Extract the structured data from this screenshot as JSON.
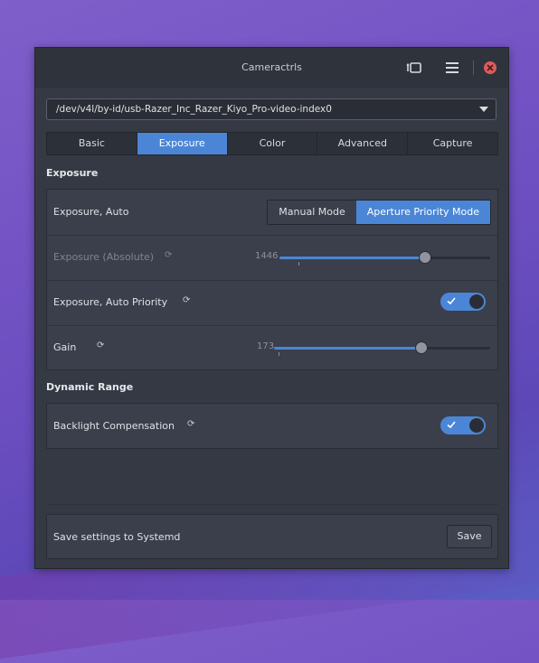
{
  "window": {
    "title": "Cameractrls",
    "icons": [
      "camera-switch-icon",
      "hamburger-menu-icon",
      "close-icon"
    ]
  },
  "device": {
    "selected": "/dev/v4l/by-id/usb-Razer_Inc_Razer_Kiyo_Pro-video-index0"
  },
  "tabs": [
    {
      "label": "Basic",
      "active": false
    },
    {
      "label": "Exposure",
      "active": true
    },
    {
      "label": "Color",
      "active": false
    },
    {
      "label": "Advanced",
      "active": false
    },
    {
      "label": "Capture",
      "active": false
    }
  ],
  "exposure": {
    "title": "Exposure",
    "auto": {
      "label": "Exposure, Auto",
      "options": [
        "Manual Mode",
        "Aperture Priority Mode"
      ],
      "selected": "Aperture Priority Mode"
    },
    "absolute": {
      "label": "Exposure (Absolute)",
      "value": "1446",
      "level": 0.69,
      "default_level": 0.09,
      "disabled": true
    },
    "auto_priority": {
      "label": "Exposure, Auto Priority",
      "on": true
    },
    "gain": {
      "label": "Gain",
      "value": "173",
      "level": 0.68,
      "default_level": 0.02
    }
  },
  "dynamic_range": {
    "title": "Dynamic Range",
    "backlight": {
      "label": "Backlight Compensation",
      "on": true
    }
  },
  "systemd": {
    "label": "Save settings to Systemd",
    "button": "Save"
  },
  "colors": {
    "accent": "#4b86d6",
    "window_bg": "#353944",
    "panel_bg": "#3b3f4b",
    "close": "#e05a5a"
  }
}
